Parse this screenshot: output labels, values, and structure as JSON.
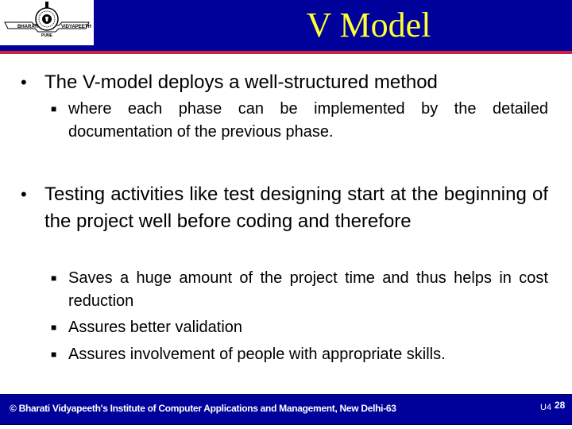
{
  "header": {
    "title": "V Model",
    "logo": {
      "left_text": "BHARATI",
      "right_text": "VIDYAPEETH",
      "bottom_text": "PUNE"
    }
  },
  "bullets": [
    {
      "text": "The V-model deploys a well-structured method",
      "sub": [
        {
          "text": "where each phase can be implemented by the detailed documentation of the previous phase."
        }
      ]
    },
    {
      "text": "Testing activities like test designing start at the beginning of the project well before coding and therefore",
      "sub": [
        {
          "text": "Saves a huge amount of the project time and thus helps in cost reduction"
        },
        {
          "text": "Assures better validation"
        },
        {
          "text": "Assures involvement of people with appropriate skills."
        }
      ]
    }
  ],
  "glyphs": {
    "bullet": "•",
    "sub_bullet": "■"
  },
  "footer": {
    "copyright": "© Bharati Vidyapeeth's Institute of Computer Applications and Management, New Delhi-63",
    "unit": "U4",
    "page": "28"
  },
  "colors": {
    "header_bg": "#00009a",
    "title": "#ffff33",
    "rule": "#d0203a",
    "footer_bg": "#00009a"
  }
}
